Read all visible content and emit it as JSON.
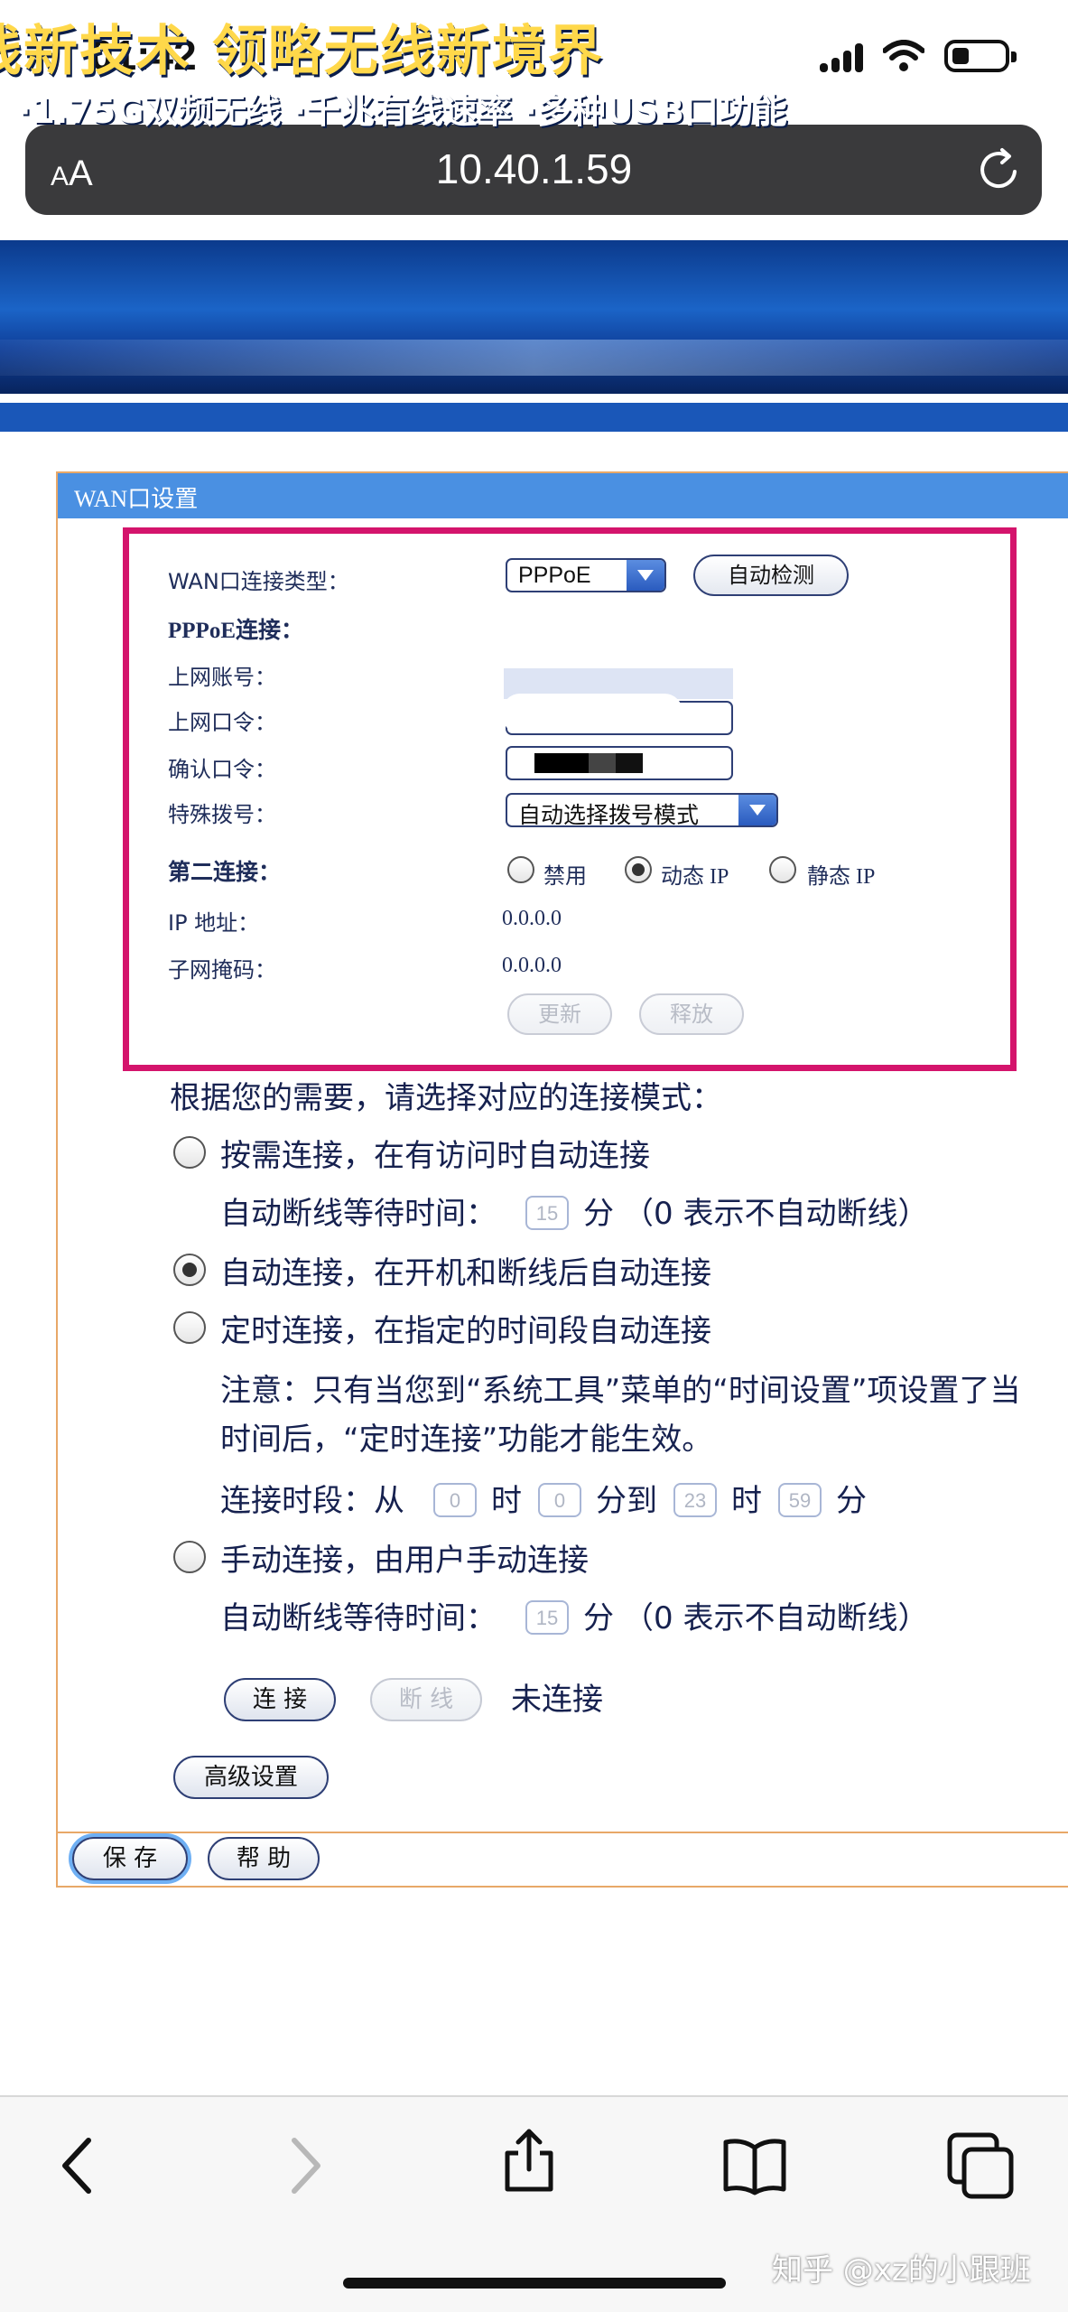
{
  "status_bar": {
    "time": "01:42"
  },
  "browser": {
    "aa_small": "A",
    "aa_big": "A",
    "url": "10.40.1.59"
  },
  "banner": {
    "line1": "线新技术   领略无线新境界",
    "line2": "·1.75G双频无线   ·千兆有线速率   ·多种USB口功能"
  },
  "panel": {
    "title": "WAN口设置",
    "wan_type_label": "WAN口连接类型：",
    "wan_type_value": "PPPoE",
    "auto_detect": "自动检测",
    "pppoe_heading": "PPPoE连接：",
    "account_label": "上网账号：",
    "password_label": "上网口令：",
    "confirm_label": "确认口令：",
    "special_dial_label": "特殊拨号：",
    "special_dial_value": "自动选择拨号模式",
    "second_conn_label": "第二连接：",
    "second_conn_options": [
      "禁用",
      "动态 IP",
      "静态 IP"
    ],
    "second_conn_selected": "动态 IP",
    "ip_label": "IP 地址：",
    "ip_value": "0.0.0.0",
    "mask_label": "子网掩码：",
    "mask_value": "0.0.0.0",
    "renew": "更新",
    "release": "释放"
  },
  "modes": {
    "intro": "根据您的需要，请选择对应的连接模式：",
    "on_demand": "按需连接，在有访问时自动连接",
    "idle_wait_label": "自动断线等待时间：",
    "idle_wait_value": "15",
    "idle_wait_unit": "分",
    "idle_wait_note": "（0 表示不自动断线）",
    "auto": "自动连接，在开机和断线后自动连接",
    "timed": "定时连接，在指定的时间段自动连接",
    "note_line1": "注意：只有当您到“系统工具”菜单的“时间设置”项设置了当",
    "note_line2": "时间后，“定时连接”功能才能生效。",
    "period_label": "连接时段：从",
    "from_hour": "0",
    "hour_unit": "时",
    "from_min": "0",
    "to_label": "分到",
    "to_hour": "23",
    "to_min": "59",
    "min_unit": "分",
    "manual": "手动连接，由用户手动连接",
    "idle_wait_value2": "15",
    "selected": "auto",
    "connect": "连 接",
    "disconnect": "断 线",
    "status": "未连接",
    "advanced": "高级设置",
    "save": "保 存",
    "help": "帮 助"
  },
  "watermark": "知乎 @xz的小跟班",
  "colors": {
    "highlight": "#d4146c",
    "panel_header": "#4a90e2",
    "banner": "#1b64c7"
  }
}
